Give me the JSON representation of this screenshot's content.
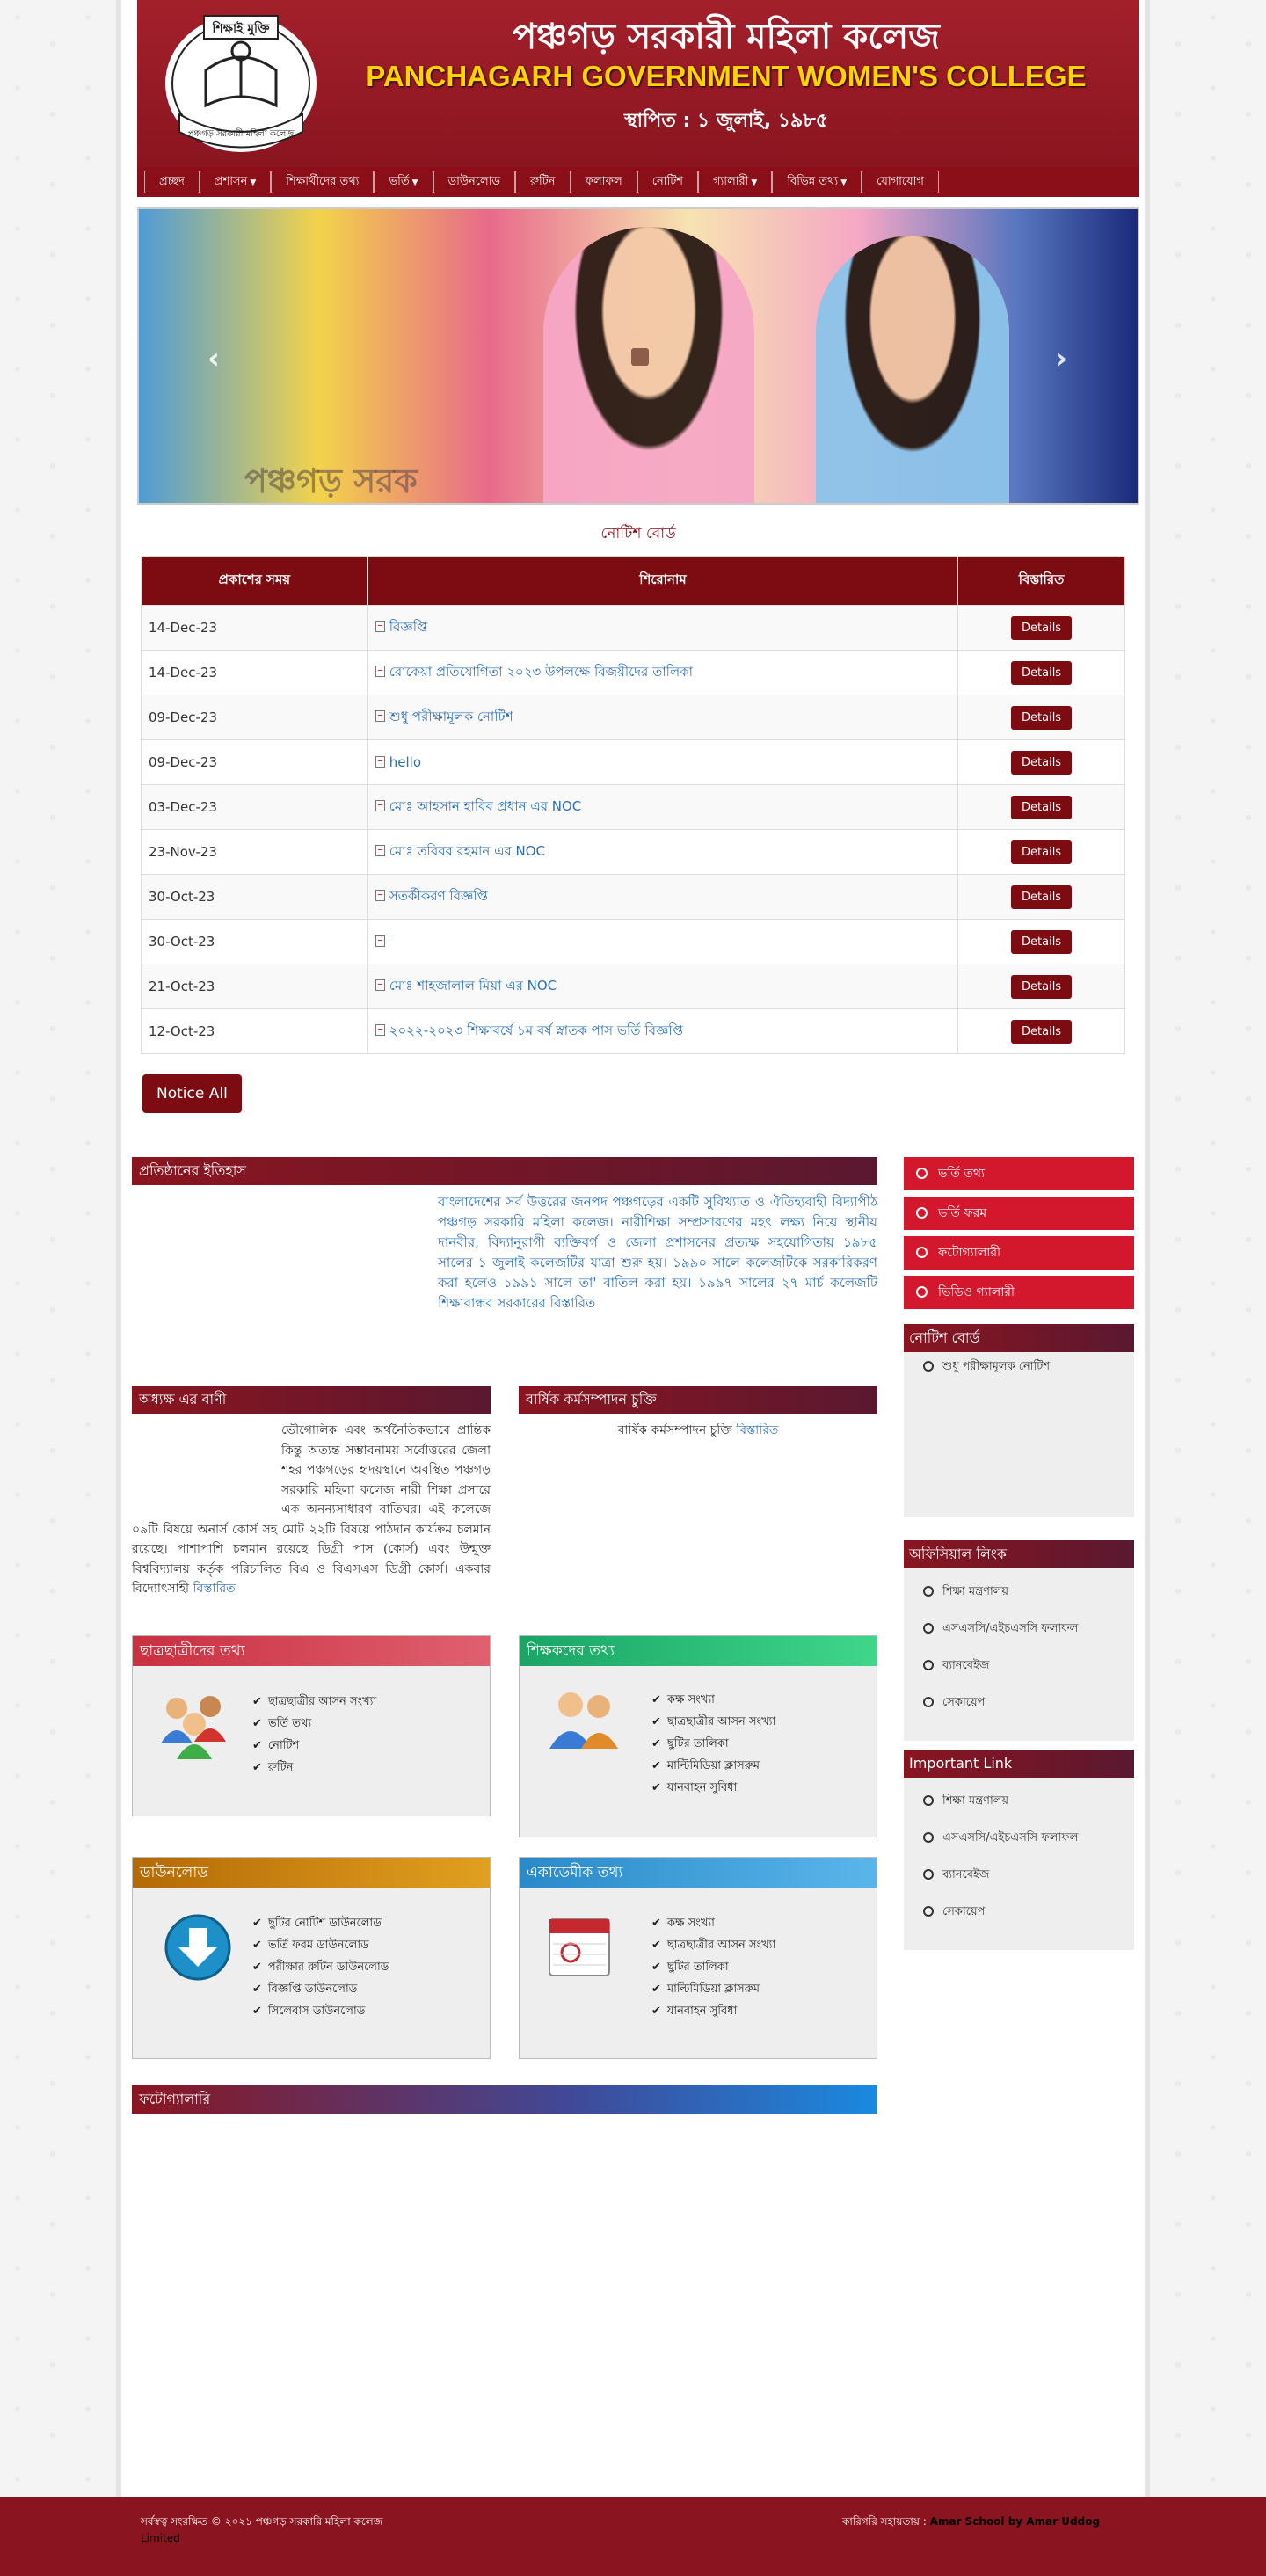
{
  "header": {
    "title_bn": "পঞ্চগড় সরকারী মহিলা কলেজ",
    "title_en": "PANCHAGARH GOVERNMENT WOMEN'S COLLEGE",
    "established": "স্থাপিত : ১ জুলাই, ১৯৮৫",
    "logo_text_top": "শিক্ষাই মুক্তি",
    "logo_text_bottom": "পঞ্চগড় সরকারী মহিলা কলেজ"
  },
  "nav": [
    {
      "label": "প্রচ্ছদ",
      "dropdown": false
    },
    {
      "label": "প্রশাসন",
      "dropdown": true
    },
    {
      "label": "শিক্ষার্থীদের তথ্য",
      "dropdown": false
    },
    {
      "label": "ভর্তি",
      "dropdown": true
    },
    {
      "label": "ডাউনলোড",
      "dropdown": false
    },
    {
      "label": "রুটিন",
      "dropdown": false
    },
    {
      "label": "ফলাফল",
      "dropdown": false
    },
    {
      "label": "নোটিশ",
      "dropdown": false
    },
    {
      "label": "গ্যালারী",
      "dropdown": true
    },
    {
      "label": "বিভিন্ন তথ্য",
      "dropdown": true
    },
    {
      "label": "যোগাযোগ",
      "dropdown": false
    }
  ],
  "slider": {
    "banner_text": "পঞ্চগড় সরক",
    "prev": "‹",
    "next": "›"
  },
  "notice_board": {
    "title": "নোটিশ বোর্ড",
    "columns": [
      "প্রকাশের সময়",
      "শিরোনাম",
      "বিস্তারিত"
    ],
    "rows": [
      {
        "date": "14-Dec-23",
        "title": "বিজ্ঞপ্তি",
        "action": "Details"
      },
      {
        "date": "14-Dec-23",
        "title": "রোকেয়া প্রতিযোগিতা ২০২৩ উপলক্ষে বিজয়ীদের তালিকা",
        "action": "Details"
      },
      {
        "date": "09-Dec-23",
        "title": "শুধু পরীক্ষামূলক নোটিশ",
        "action": "Details"
      },
      {
        "date": "09-Dec-23",
        "title": "hello",
        "action": "Details"
      },
      {
        "date": "03-Dec-23",
        "title": "মোঃ আহসান হাবিব প্রধান এর NOC",
        "action": "Details"
      },
      {
        "date": "23-Nov-23",
        "title": "মোঃ তবিবর রহমান এর NOC",
        "action": "Details"
      },
      {
        "date": "30-Oct-23",
        "title": "সতর্কীকরণ বিজ্ঞপ্তি",
        "action": "Details"
      },
      {
        "date": "30-Oct-23",
        "title": "",
        "action": "Details"
      },
      {
        "date": "21-Oct-23",
        "title": "মোঃ শাহজালাল মিয়া এর NOC",
        "action": "Details"
      },
      {
        "date": "12-Oct-23",
        "title": "২০২২-২০২৩ শিক্ষাবর্ষে ১ম বর্ষ স্নাতক পাস ভর্তি বিজ্ঞপ্তি",
        "action": "Details"
      }
    ],
    "notice_all": "Notice All"
  },
  "history": {
    "heading": "প্রতিষ্ঠানের ইতিহাস",
    "text": "বাংলাদেশের সর্ব উত্তরের জনপদ পঞ্চগড়ের একটি সুবিখ্যাত ও ঐতিহ্যবাহী বিদ্যাপীঠ পঞ্চগড় সরকারি মহিলা কলেজ। নারীশিক্ষা সম্প্রসারণের মহৎ লক্ষ্য নিয়ে স্থানীয় দানবীর, বিদ্যানুরাগী ব্যক্তিবর্গ ও জেলা প্রশাসনের প্রত্যক্ষ সহযোগিতায় ১৯৮৫ সালের ১ জুলাই কলেজটির যাত্রা শুরু হয়। ১৯৯০ সালে কলেজটিকে সরকারিকরণ করা হলেও ১৯৯১ সালে তা' বাতিল করা হয়। ১৯৯৭ সালের ২৭ মার্চ কলেজটি শিক্ষাবান্ধব সরকারের বিস্তারিত"
  },
  "principal": {
    "heading": "অধ্যক্ষ এর বাণী",
    "text": "ভৌগোলিক এবং অর্থনৈতিকভাবে প্রান্তিক কিন্তু অত্যন্ত সম্ভাবনাময় সর্বোত্তরের জেলা শহর পঞ্চগড়ের হৃদয়স্থানে অবস্থিত পঞ্চগড় সরকারি মহিলা কলেজ নারী শিক্ষা প্রসারে এক অনন্যসাধারণ বাতিঘর। এই কলেজে ০৯টি বিষয়ে অনার্স কোর্স সহ মোট ২২টি বিষয়ে পাঠদান কার্যক্রম চলমান রয়েছে। পাশাপাশি চলমান রয়েছে ডিগ্রী পাস (কোর্স) এবং উন্মুক্ত বিশ্ববিদ্যালয় কর্তৃক পরিচালিত বিএ ও বিএসএস ডিগ্রী কোর্স। একবার বিদ্যোৎসাহী",
    "more": "বিস্তারিত"
  },
  "apa": {
    "heading": "বার্ষিক কর্মসম্পাদন চুক্তি",
    "text": "বার্ষিক কর্মসম্পাদন চুক্তি",
    "more": "বিস্তারিত"
  },
  "sidebar_buttons": [
    "ভর্তি তথ্য",
    "ভর্তি ফরম",
    "ফটোগ্যালারী",
    "ভিডিও গ্যালারী"
  ],
  "side_notice": {
    "heading": "নোটিশ বোর্ড",
    "items": [
      "শুধু পরীক্ষামূলক নোটিশ"
    ]
  },
  "official_links": {
    "heading": "অফিসিয়াল লিংক",
    "items": [
      "শিক্ষা মন্ত্রণালয়",
      "এসএসসি/এইচএসসি ফলাফল",
      "ব্যানবেইজ",
      "সেকায়েপ"
    ]
  },
  "important_links": {
    "heading": "Important Link",
    "items": [
      "শিক্ষা মন্ত্রণালয়",
      "এসএসসি/এইচএসসি ফলাফল",
      "ব্যানবেইজ",
      "সেকায়েপ"
    ]
  },
  "students_info": {
    "heading": "ছাত্রছাত্রীদের তথ্য",
    "icon": "students-icon",
    "items": [
      "ছাত্রছাত্রীর আসন সংখ্যা",
      "ভর্তি তথ্য",
      "নোটিশ",
      "রুটিন"
    ]
  },
  "teachers_info": {
    "heading": "শিক্ষকদের তথ্য",
    "icon": "teachers-icon",
    "items": [
      "কক্ষ সংখ্যা",
      "ছাত্রছাত্রীর আসন সংখ্যা",
      "ছুটির তালিকা",
      "মাল্টিমিডিয়া ক্লাসরুম",
      "যানবাহন সুবিধা"
    ]
  },
  "download": {
    "heading": "ডাউনলোড",
    "icon": "download-icon",
    "items": [
      "ছুটির নোটিশ ডাউনলোড",
      "ভর্তি ফরম ডাউনলোড",
      "পরীক্ষার রুটিন ডাউনলোড",
      "বিজ্ঞপ্তি ডাউনলোড",
      "সিলেবাস ডাউনলোড"
    ]
  },
  "academic": {
    "heading": "একাডেমীক তথ্য",
    "icon": "calendar-icon",
    "items": [
      "কক্ষ সংখ্যা",
      "ছাত্রছাত্রীর আসন সংখ্যা",
      "ছুটির তালিকা",
      "মাল্টিমিডিয়া ক্লাসরুম",
      "যানবাহন সুবিধা"
    ]
  },
  "gallery": {
    "heading": "ফটোগ্যালারি"
  },
  "footer": {
    "copyright": "সর্বস্বত্ব সংরক্ষিত © ২০২১ পঞ্চগড় সরকারি মহিলা কলেজ",
    "copyright_line2": "Limited",
    "tech_label": "কারিগরি সহায়তায় :",
    "tech_vendor": "Amar School by Amar Uddog"
  },
  "colors": {
    "brand": "#8a1520",
    "nav": "#8a0f18",
    "title_en": "#ffd200",
    "sidebar_button": "#d3172c",
    "students_head": "#d04050",
    "teachers_head": "#2ec27a",
    "download_head": "#d38a10",
    "academic_head": "#3a9ad8"
  }
}
